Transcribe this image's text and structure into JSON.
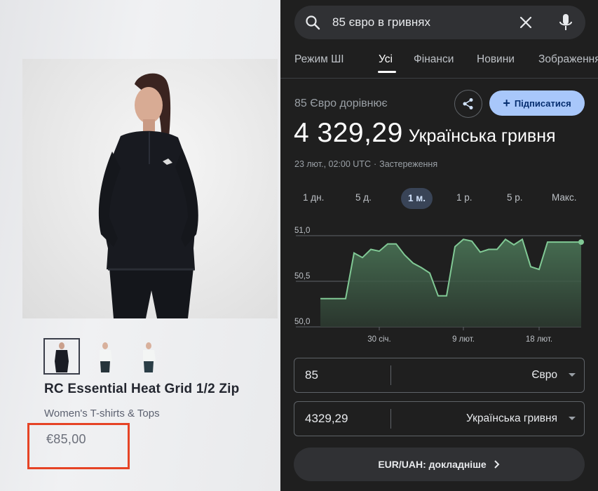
{
  "product_page": {
    "title": "RC Essential Heat Grid 1/2 Zip",
    "category": "Women's T-shirts & Tops",
    "price": "€85,00",
    "highlight_color": "#e64325"
  },
  "search": {
    "query": "85 євро в гривнях",
    "icons": [
      "search-icon",
      "close-icon",
      "mic-icon"
    ]
  },
  "tabs": [
    {
      "label": "Режим ШІ"
    },
    {
      "label": "Усі",
      "active": true
    },
    {
      "label": "Фінанси"
    },
    {
      "label": "Новини"
    },
    {
      "label": "Зображення"
    }
  ],
  "converter": {
    "equals_label": "85 Євро дорівнює",
    "result_value": "4 329,29",
    "result_currency": "Українська гривня",
    "timestamp": "23 лют., 02:00 UTC",
    "disclaimer": "Застереження",
    "subscribe_label": "Підписатися",
    "from_amount": "85",
    "from_currency": "Євро",
    "to_amount": "4329,29",
    "to_currency": "Українська гривня",
    "details_label": "EUR/UAH: докладніше"
  },
  "ranges": [
    {
      "label": "1 дн."
    },
    {
      "label": "5 д."
    },
    {
      "label": "1 м.",
      "active": true
    },
    {
      "label": "1 р."
    },
    {
      "label": "5 р."
    },
    {
      "label": "Макс."
    }
  ],
  "chart_data": {
    "type": "area",
    "title": "",
    "xlabel": "",
    "ylabel": "",
    "ylim": [
      50.0,
      51.0
    ],
    "yticks": [
      "51,0",
      "50,5",
      "50,0"
    ],
    "xticks": [
      "30 січ.",
      "9 лют.",
      "18 лют."
    ],
    "grid": true,
    "color": "#81c995",
    "series": [
      {
        "x": [
          "23 січ.",
          "24 січ.",
          "25 січ.",
          "26 січ.",
          "27 січ.",
          "28 січ.",
          "29 січ.",
          "30 січ.",
          "31 січ.",
          "1 лют.",
          "2 лют.",
          "3 лют.",
          "4 лют.",
          "5 лют.",
          "6 лют.",
          "7 лют.",
          "8 лют.",
          "9 лют.",
          "10 лют.",
          "11 лют.",
          "12 лют.",
          "13 лют.",
          "14 лют.",
          "15 лют.",
          "16 лют.",
          "17 лют.",
          "18 лют.",
          "19 лют.",
          "20 лют.",
          "21 лют.",
          "22 лют.",
          "23 лют."
        ],
        "values": [
          50.31,
          50.31,
          50.31,
          50.31,
          50.81,
          50.76,
          50.85,
          50.83,
          50.91,
          50.91,
          50.79,
          50.7,
          50.65,
          50.59,
          50.34,
          50.34,
          50.88,
          50.96,
          50.94,
          50.82,
          50.85,
          50.85,
          50.96,
          50.9,
          50.96,
          50.66,
          50.63,
          50.93,
          50.93,
          50.93,
          50.93,
          50.93
        ]
      }
    ]
  }
}
